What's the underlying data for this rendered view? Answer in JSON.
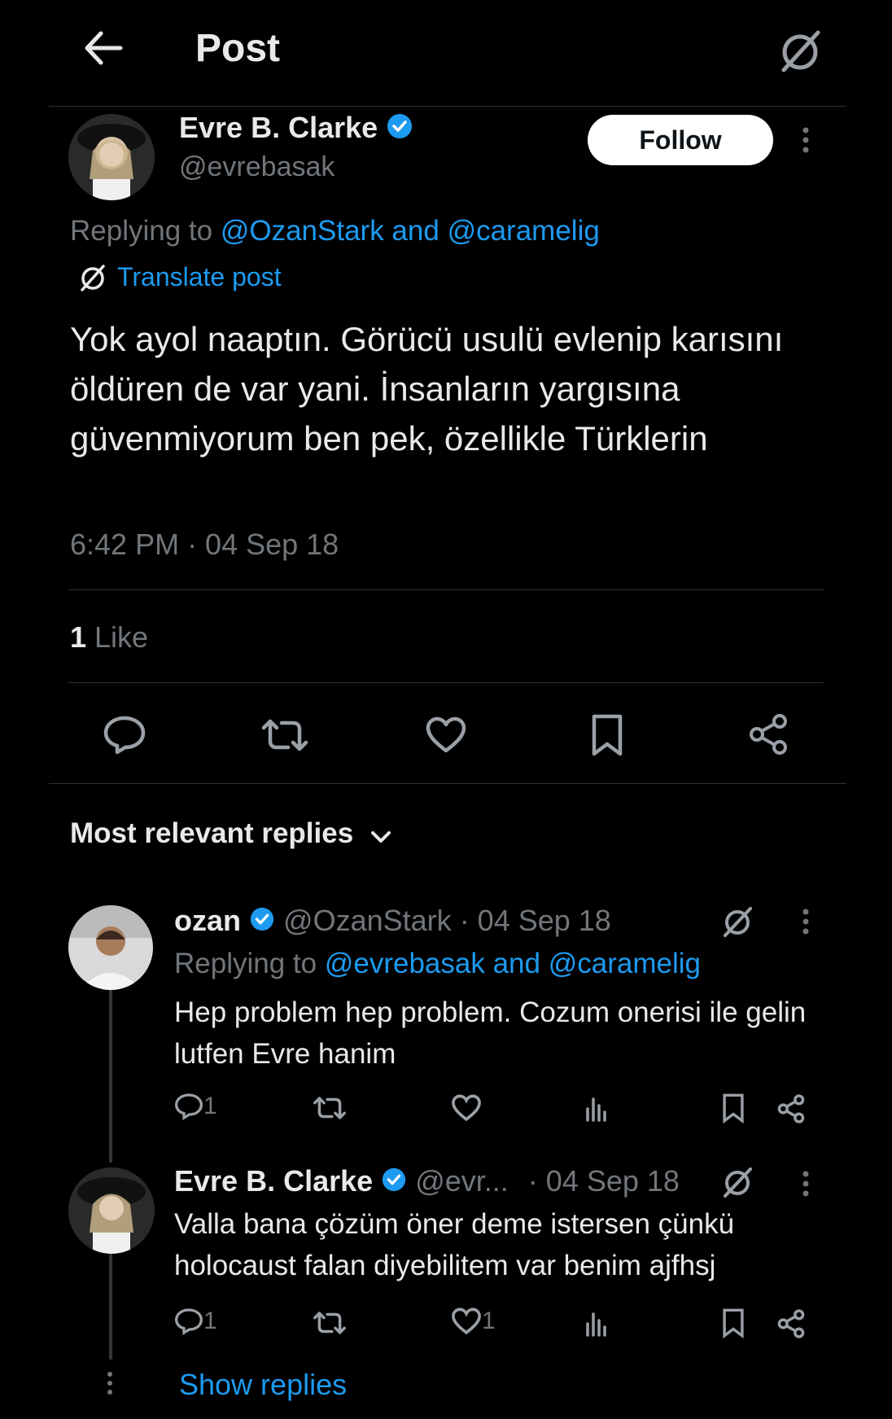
{
  "header": {
    "title": "Post"
  },
  "post": {
    "author_name": "Evre B. Clarke",
    "author_handle": "@evrebasak",
    "follow_label": "Follow",
    "replying_prefix": "Replying to ",
    "replying_to_1": "@OzanStark",
    "replying_and": " and ",
    "replying_to_2": "@caramelig",
    "translate_label": "Translate post",
    "text": "Yok ayol naaptın. Görücü usulü evlenip karısını öldüren de var yani. İnsanların yargısına güvenmiyorum ben pek, özellikle Türklerin",
    "timestamp": "6:42 PM · 04 Sep 18",
    "likes_count": "1",
    "likes_label": " Like"
  },
  "replies_sort": {
    "label": "Most relevant replies"
  },
  "replies": [
    {
      "name": "ozan",
      "handle": "@OzanStark",
      "date": "· 04 Sep 18",
      "replying_prefix": "Replying to ",
      "replying_to_1": "@evrebasak",
      "replying_and": " and ",
      "replying_to_2": "@caramelig",
      "text": "Hep problem hep problem. Cozum onerisi ile gelin lutfen Evre hanim",
      "reply_count": "1",
      "like_count": ""
    },
    {
      "name": "Evre B. Clarke",
      "handle": "@evr...",
      "date": "· 04 Sep 18",
      "text": "Valla bana çözüm öner deme istersen çünkü holocaust falan diyebilitem var benim ajfhsj",
      "reply_count": "1",
      "like_count": "1"
    }
  ],
  "show_replies": "Show replies",
  "colors": {
    "accent": "#1d9bf0",
    "background": "#000000",
    "text": "#e7e9ea",
    "muted": "#71767b"
  }
}
